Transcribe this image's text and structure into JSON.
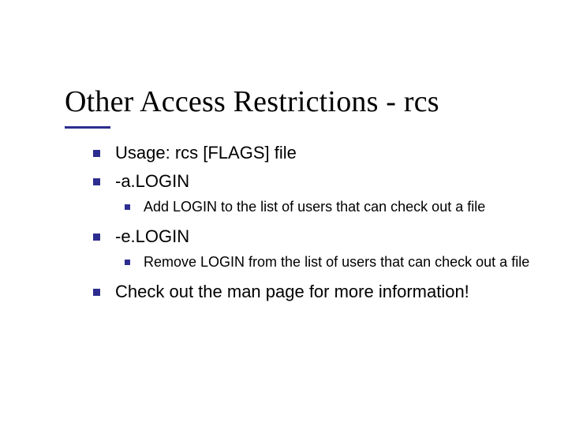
{
  "title": "Other Access Restrictions - rcs",
  "accent_color": "#2d2d8f",
  "bullets": {
    "b1": "Usage: rcs [FLAGS] file",
    "b2": "-a.LOGIN",
    "b2_sub1": "Add LOGIN to the list of users that can check out a file",
    "b3": "-e.LOGIN",
    "b3_sub1": "Remove LOGIN from the list of users that can check out a file",
    "b4": "Check out the man page for more information!"
  }
}
